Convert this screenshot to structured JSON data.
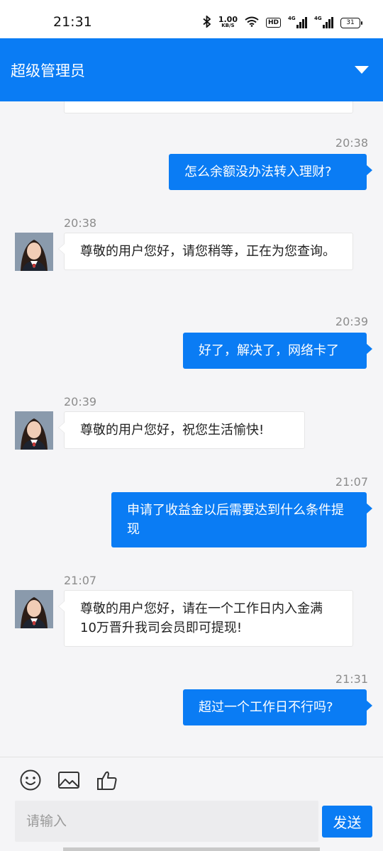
{
  "status_bar": {
    "time": "21:31",
    "net_speed": "1.00",
    "net_unit": "KB/S",
    "hd_label": "HD",
    "signal1_label": "4G",
    "signal2_label": "4G",
    "battery": "31"
  },
  "header": {
    "title": "超级管理员"
  },
  "messages": [
    {
      "time": "20:38",
      "text": "怎么余额没办法转入理财?",
      "direction": "out"
    },
    {
      "time": "20:38",
      "text": "尊敬的用户您好，请您稍等，正在为您查询。",
      "direction": "in"
    },
    {
      "time": "20:39",
      "text": "好了，解决了，网络卡了",
      "direction": "out"
    },
    {
      "time": "20:39",
      "text": "尊敬的用户您好，祝您生活愉快!",
      "direction": "in"
    },
    {
      "time": "21:07",
      "text": "申请了收益金以后需要达到什么条件提现",
      "direction": "out"
    },
    {
      "time": "21:07",
      "text": "尊敬的用户您好，请在一个工作日内入金满10万晋升我司会员即可提现!",
      "direction": "in"
    },
    {
      "time": "21:31",
      "text": "超过一个工作日不行吗?",
      "direction": "out"
    }
  ],
  "toolbar": {
    "emoji_icon": "smile-icon",
    "image_icon": "image-icon",
    "like_icon": "thumbs-up-icon",
    "input_placeholder": "请输入",
    "input_value": "",
    "send_label": "发送"
  },
  "colors": {
    "accent": "#0a7cf4",
    "background": "#f5f5f7",
    "incoming_bubble": "#ffffff",
    "timestamp": "#8c8c8c"
  }
}
